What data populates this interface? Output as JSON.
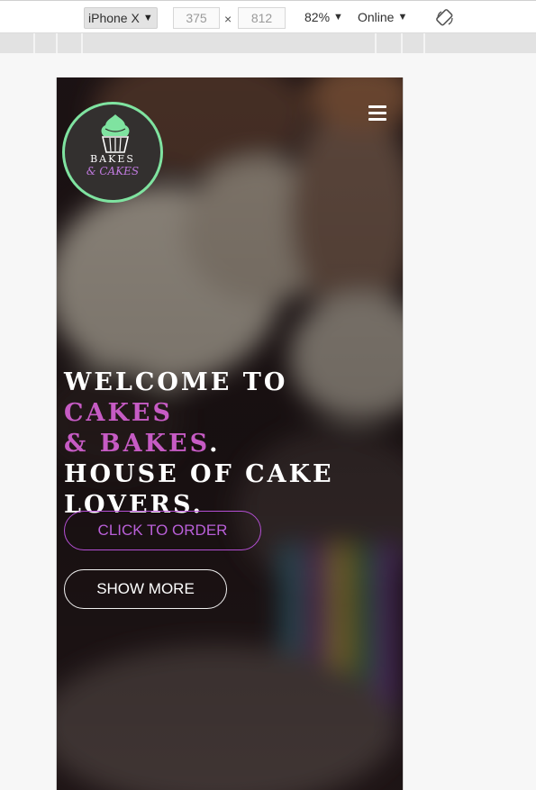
{
  "toolbar": {
    "device": "iPhone X",
    "width": "375",
    "height": "812",
    "times": "×",
    "zoom": "82%",
    "network": "Online",
    "arrow": "▼",
    "rotate_icon": "rotate-icon"
  },
  "site": {
    "logo": {
      "line1": "BAKES",
      "line2": "& CAKES",
      "ring_color": "#7fe3a0",
      "icon": "cupcake-icon"
    },
    "menu_icon": "hamburger-icon",
    "hero": {
      "line1_a": "WELCOME TO ",
      "line1_b": "CAKES",
      "line2_a": "& BAKES",
      "line2_b": ".",
      "line3": "HOUSE OF CAKE",
      "line4": "LOVERS.",
      "accent_color": "#c65bc4"
    },
    "buttons": {
      "order": "CLICK TO ORDER",
      "more": "SHOW MORE"
    }
  }
}
